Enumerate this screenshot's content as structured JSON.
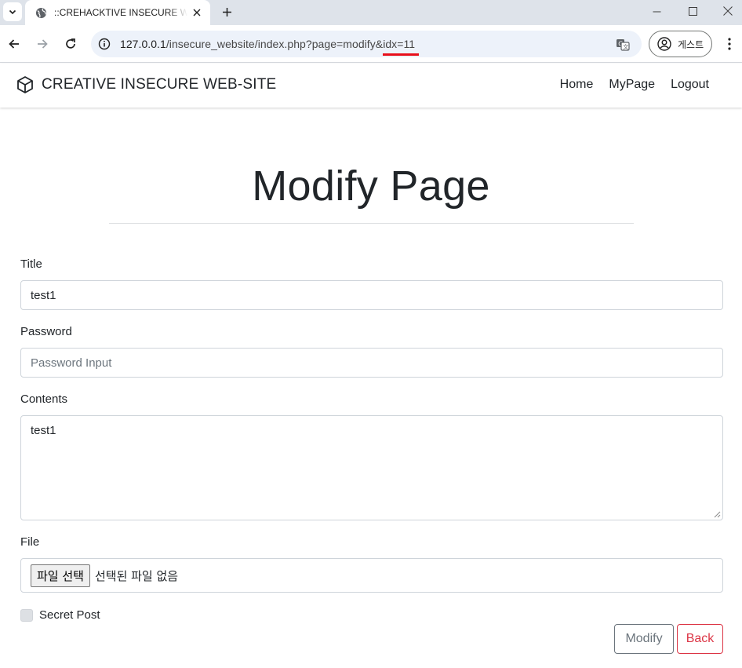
{
  "browser": {
    "tab_title": "::CREHACKTIVE INSECURE WEBSITE::",
    "url_main": "127.0.0.1",
    "url_rest": "/insecure_website/index.php?page=modify&idx=11",
    "profile_label": "게스트"
  },
  "navbar": {
    "brand": "CREATIVE INSECURE WEB-SITE",
    "links": [
      "Home",
      "MyPage",
      "Logout"
    ]
  },
  "page": {
    "title": "Modify Page"
  },
  "form": {
    "title_label": "Title",
    "title_value": "test1",
    "password_label": "Password",
    "password_placeholder": "Password Input",
    "contents_label": "Contents",
    "contents_value": "test1",
    "file_label": "File",
    "file_button": "파일 선택",
    "file_status": "선택된 파일 없음",
    "secret_label": "Secret Post",
    "secret_checked": false,
    "modify_button": "Modify",
    "back_button": "Back"
  },
  "colors": {
    "annotation_underline": "#e8101b",
    "back_button": "#dc3545",
    "modify_button": "#6c757d"
  }
}
